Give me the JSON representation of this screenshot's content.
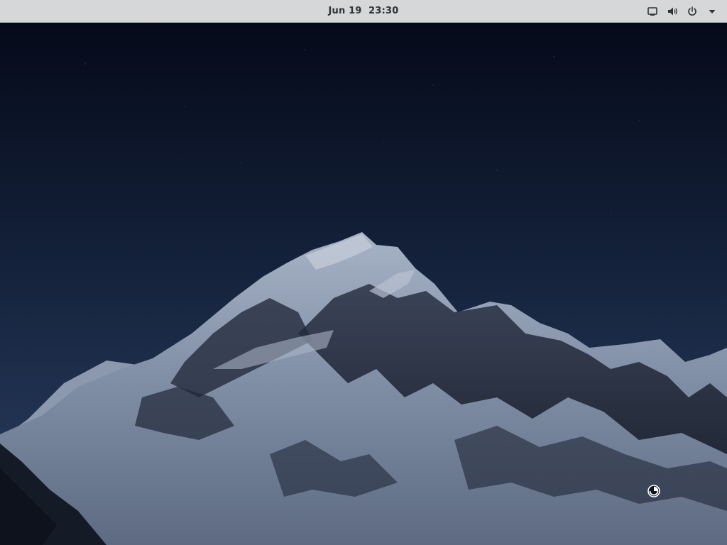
{
  "top_bar": {
    "date": "Jun 19",
    "time": "23:30",
    "status_icons": [
      "display-icon",
      "volume-icon",
      "power-icon",
      "menu-arrow-icon"
    ]
  },
  "desktop": {
    "wallpaper": "mountain-night",
    "colors": {
      "sky_top": "#060b1a",
      "sky_bottom": "#26395a",
      "snow": "#8e9db4",
      "rock": "#1d2434",
      "panel": "#d6d7d9",
      "panel_text": "#2e3436"
    }
  },
  "cursor": "busy-cursor-icon"
}
